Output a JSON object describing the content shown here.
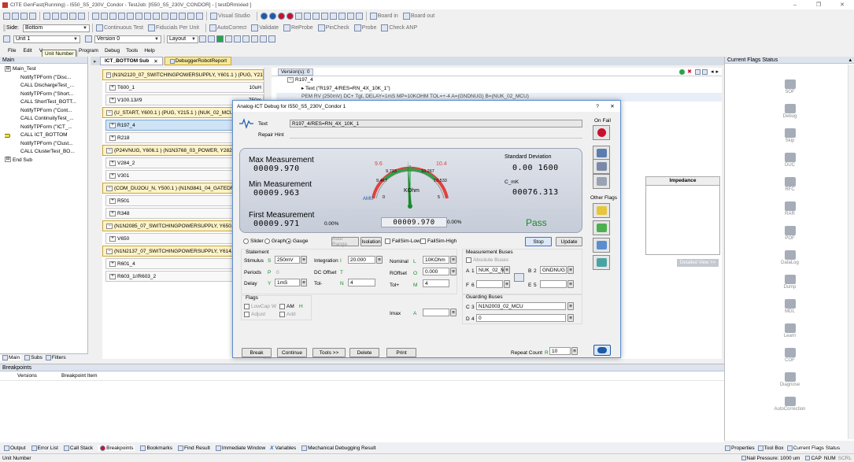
{
  "window": {
    "title": "CITE GenFast(Running) - I550_S5_230V_Condor - TestJob: [I550_S5_230V_CONDOR] - [ testDRmixied ]",
    "controls": [
      "–",
      "❐",
      "✕"
    ]
  },
  "toolbar1": {
    "visual_studio": "Visual Studio",
    "board_in": "Board in",
    "board_out": "Board out"
  },
  "toolbar2": {
    "side_label": "Side:",
    "side_value": "Bottom",
    "continuous_test": "Continuous Test",
    "fiducials": "Fiducials Per Unit",
    "autocorrect": "AutoCorrect",
    "validate": "Validate",
    "reprobe": "ReProbe",
    "pincheck": "PinCheck",
    "probe": "Probe",
    "check_anp": "Check ANP"
  },
  "toolbar3": {
    "unit_value": "Unit 1",
    "version_value": "Version 0",
    "layout": "Layout",
    "tooltip": "Unit Number"
  },
  "menu": [
    "File",
    "Edit",
    "V",
    "Program",
    "Debug",
    "Tools",
    "Help"
  ],
  "main_panel": {
    "title": "Main",
    "tree": [
      {
        "level": 0,
        "box": "⊟",
        "label": "Main_Test"
      },
      {
        "level": 1,
        "label": "NotifyTPForm (\"Disc..."
      },
      {
        "level": 1,
        "label": "CALL DischargeTest_..."
      },
      {
        "level": 1,
        "label": "NotifyTPForm (\"Short..."
      },
      {
        "level": 1,
        "label": "CALL ShortTest_BOTT..."
      },
      {
        "level": 1,
        "label": "NotifyTPForm (\"Cont..."
      },
      {
        "level": 1,
        "label": "CALL ContinuityTest_..."
      },
      {
        "level": 1,
        "label": "NotifyTPForm (\"ICT_..."
      },
      {
        "level": 1,
        "label": "CALL ICT_BOTTOM"
      },
      {
        "level": 1,
        "label": "NotifyTPForm (\"Clust..."
      },
      {
        "level": 1,
        "label": "CALL ClusterTest_BO..."
      },
      {
        "level": 0,
        "box": "⊟",
        "label": "End Sub"
      }
    ],
    "bottom_tabs": [
      "Main",
      "Subs",
      "Filters"
    ]
  },
  "doc_tabs": [
    "ICT_BOTTOM Sub",
    "DebuggerRobotReport"
  ],
  "test_list": [
    {
      "type": "group",
      "label": "(N1N2120_07_SWITCHINGPOWERSUPPLY, Y601.1 ) (PUG, Y21..."
    },
    {
      "type": "item",
      "label": "T600_1",
      "value": "10uH"
    },
    {
      "type": "item",
      "label": "V100.13//9",
      "value": "750m"
    },
    {
      "type": "group",
      "label": "(U_START, Y600.1 ) (PUG, Y215.1 ) (NUK_02_MCU, Y..."
    },
    {
      "type": "item",
      "label": "R197_4",
      "value": "10",
      "selected": true
    },
    {
      "type": "item",
      "label": "R218",
      "value": "345"
    },
    {
      "type": "group",
      "label": "(P24VNUG, Y606.1 ) (N1N3768_03_POWER, Y282.1 ) ("
    },
    {
      "type": "item",
      "label": "V284_2",
      "value": ""
    },
    {
      "type": "item",
      "label": "V301",
      "value": "633"
    },
    {
      "type": "group",
      "label": "(COM_DU2OU_N, Y500.1 ) (N1N3841_04_GATEDRIVE"
    },
    {
      "type": "item",
      "label": "R501",
      "value": ""
    },
    {
      "type": "item",
      "label": "R348",
      "value": "22"
    },
    {
      "type": "group",
      "label": "(N1N2085_07_SWITCHINGPOWERSUPPLY, Y650.1 ) ("
    },
    {
      "type": "item",
      "label": "V650",
      "value": "467"
    },
    {
      "type": "group",
      "label": "(N1N2137_07_SWITCHINGPOWERSUPPLY, Y614.1 ) ("
    },
    {
      "type": "item",
      "label": "R601_4",
      "value": "20"
    },
    {
      "type": "item",
      "label": "R603_1//R603_2",
      "value": "15"
    }
  ],
  "version_panel": {
    "tab": "Version(s): 0",
    "tree": [
      "R197_4",
      "Text (\"R197_4/RES=RN_4X_10K_1\")",
      "PEM RV (250mV) DC+ Tgt, DELAY=1mS MP=10KOHM TOL=+-4 A=(GNDNUG) B=(NUK_02_MCU)"
    ],
    "impedance_header": "Impedance",
    "detailed_view": "Detailed View >>"
  },
  "dialog": {
    "title": "Analog-ICT Debug for I550_S5_230V_Condor 1",
    "help": "?",
    "close": "✕",
    "text_label": "Text",
    "text_value": "R197_4/RES=RN_4X_10K_1",
    "repair_hint": "Repair Hint",
    "on_fail": "On Fail",
    "other_flags": "Other Flags",
    "max_label": "Max Measurement",
    "max_value": "00009.970",
    "min_label": "Min Measurement",
    "min_value": "00009.963",
    "first_label": "First Measurement",
    "first_value": "00009.971",
    "first_pct": "0.00%",
    "std_label": "Standard Deviation",
    "std_value": "0.00 1600",
    "cmk_label": "C_mK",
    "cmk_value": "00076.313",
    "current_value": "00009.970",
    "current_pct": "0.00%",
    "result": "Pass",
    "gauge": {
      "low": "9.6",
      "high": "10.4",
      "t1": "9.733",
      "t2": "10.267",
      "t3": "9.467",
      "t4": "10.533",
      "unit": "KOhm",
      "amu": "AMU",
      "scale_min": "0",
      "scale_max": "5",
      "current": 9.97
    },
    "mode_slider": "Slider",
    "mode_graph": "Graph",
    "mode_gauge": "Gauge",
    "auto_range": "Auto Range",
    "isolation": "Isolation",
    "failsim_low": "FailSim-Low",
    "failsim_high": "FailSim-High",
    "stop": "Stop",
    "update": "Update",
    "statement": "Statement",
    "stimulus": "Stimulus",
    "stimulus_key": "S",
    "stimulus_value": "250mV",
    "periods": "Periods",
    "periods_key": "P",
    "periods_value": "0",
    "delay": "Delay",
    "delay_key": "Y",
    "delay_value": "1mS",
    "integration": "Integration",
    "integration_key": "I",
    "integration_value": "20.000",
    "dc_offset": "DC Offset",
    "dc_offset_key": "T",
    "tol_minus": "Tol-",
    "tol_minus_key": "N",
    "tol_minus_value": "4",
    "nominal": "Nominal",
    "nominal_key": "L",
    "nominal_value": "10KOhm",
    "roffset": "ROffset",
    "roffset_key": "O",
    "roffset_value": "0.000",
    "tol_plus": "Tol+",
    "tol_plus_key": "M",
    "tol_plus_value": "4",
    "imax": "Imax",
    "imax_key": "A",
    "flags": "Flags",
    "lowcap": "LowCap",
    "lowcap_key": "W",
    "am": "AM",
    "am_key": "H",
    "adjust": "Adjust",
    "add": "Add",
    "measurement_buses": "Measurement Buses",
    "absolute_buses": "Absolute Buses",
    "bus_a_key": "A",
    "bus_a_num": "1",
    "bus_a_value": "NUK_02_M",
    "bus_b_key": "B",
    "bus_b_num": "2",
    "bus_b_value": "GNDNUG",
    "bus_f_key": "F",
    "bus_f_num": "6",
    "bus_e_key": "E",
    "bus_e_num": "5",
    "guarding_buses": "Guarding Buses",
    "bus_c_key": "C",
    "bus_c_num": "3",
    "bus_c_value": "N1N2003_02_MCU",
    "bus_d_key": "D",
    "bus_d_num": "4",
    "bus_d_value": "0",
    "break": "Break",
    "continue": "Continue",
    "tools": "Tools >>",
    "delete": "Delete",
    "print": "Print",
    "repeat_count": "Repeat Count",
    "repeat_key": "R",
    "repeat_value": "10"
  },
  "right_panel": {
    "title": "Current Flags Status",
    "tools": [
      "SOF",
      "Debug",
      "Skip",
      "DUC",
      "RFC",
      "RAR",
      "POF",
      "DataLog",
      "Dump",
      "MDL",
      "Learn",
      "COF",
      "Diagnose",
      "AutoCorrection"
    ]
  },
  "breakpoints": {
    "title": "Breakpoints",
    "col_versions": "Versions",
    "col_item": "Breakpoint Item"
  },
  "bottom_tabs": [
    "Output",
    "Error List",
    "Call Stack",
    "Breakpoints",
    "Bookmarks",
    "Find Result",
    "Immediate Window",
    "Variables",
    "Mechanical Debugging Result"
  ],
  "bottom_right_tabs": [
    "Properties",
    "Tool Box",
    "Current Flags Status"
  ],
  "status": {
    "left": "Unit Number",
    "nail": "Nail Pressure: 1000 um",
    "caps": "CAP",
    "num": "NUM",
    "scrl": "SCRL"
  },
  "colors": {
    "accent": "#1e5aa8",
    "pass": "#1b8a2a",
    "gauge_red": "#e0423a",
    "gauge_green": "#2aa24a",
    "stop_red": "#c8102e"
  }
}
